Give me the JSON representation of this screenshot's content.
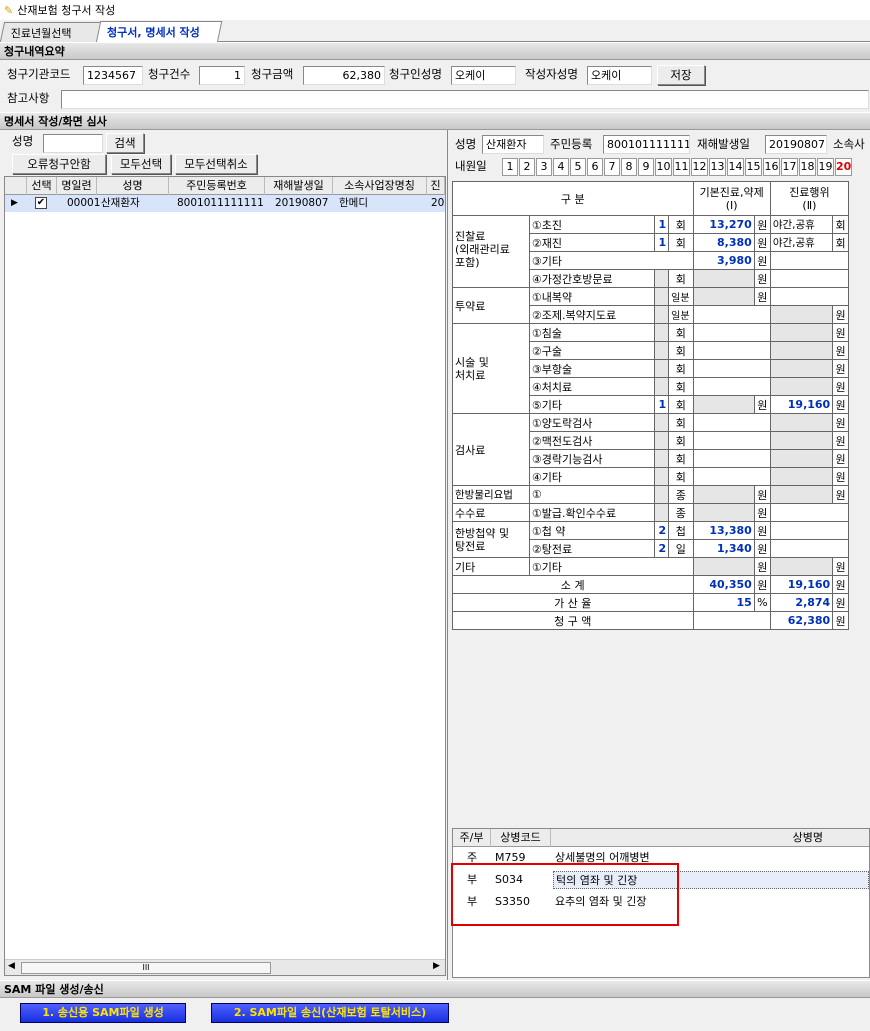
{
  "window": {
    "title": "산재보험 청구서 작성"
  },
  "tabs": [
    {
      "label": "진료년월선택"
    },
    {
      "label": "청구서, 명세서 작성"
    }
  ],
  "summary": {
    "header": "청구내역요약",
    "inst_code_label": "청구기관코드",
    "inst_code": "1234567",
    "count_label": "청구건수",
    "count": "1",
    "amount_label": "청구금액",
    "amount": "62,380",
    "claimant_label": "청구인성명",
    "claimant": "오케이",
    "writer_label": "작성자성명",
    "writer": "오케이",
    "save": "저장",
    "note_label": "참고사항",
    "note": ""
  },
  "review": {
    "header": "명세서 작성/화면 심사"
  },
  "left": {
    "name_label": "성명",
    "name_value": "",
    "search": "검색",
    "btn_error": "오류청구안함",
    "btn_select_all": "모두선택",
    "btn_deselect_all": "모두선택취소",
    "columns": [
      "선택",
      "명일련",
      "성명",
      "주민등록번호",
      "재해발생일",
      "소속사업장명칭",
      "진"
    ],
    "row": {
      "serial": "00001",
      "name": "산재환자",
      "rrn": "8001011111111",
      "date": "20190807",
      "company": "한메디",
      "extra": "20"
    }
  },
  "right": {
    "name_label": "성명",
    "name": "산재환자",
    "rrn_label": "주민등록",
    "rrn": "8001011111111",
    "date_label": "재해발생일",
    "date": "20190807",
    "company_label": "소속사",
    "visit_label": "내원일",
    "days": [
      "1",
      "2",
      "3",
      "4",
      "5",
      "6",
      "7",
      "8",
      "9",
      "10",
      "11",
      "12",
      "13",
      "14",
      "15",
      "16",
      "17",
      "18",
      "19",
      "20"
    ],
    "table": {
      "h_cat": "구 분",
      "h_basic": "기본진료,약제",
      "h_basic2": "(Ⅰ)",
      "h_act": "진료행위",
      "h_act2": "(Ⅱ)",
      "won": "원",
      "hoe": "회",
      "ilbun": "일분",
      "jong": "종",
      "cheop": "첩",
      "il": "일",
      "g_jinchal": "진찰료",
      "g_jinchal2": "(외래관리료",
      "g_jinchal3": "포함)",
      "r_chojin": "①초진",
      "v_chojin_n": "1",
      "v_chojin": "13,270",
      "v_chojin_act": "야간,공휴",
      "r_jaejin": "②재진",
      "v_jaejin_n": "1",
      "v_jaejin": "8,380",
      "v_jaejin_act": "야간,공휴",
      "r_etc": "③기타",
      "v_etc": "3,980",
      "r_home": "④가정간호방문료",
      "g_tuyak": "투약료",
      "r_naebok": "①내복약",
      "r_jojae": "②조제.복약지도료",
      "g_sisul": "시술 및",
      "g_sisul2": "처치료",
      "r_chim": "①침술",
      "r_gu": "②구술",
      "r_buhang": "③부항술",
      "r_cheochi": "④처치료",
      "r_sisul_etc": "⑤기타",
      "v_sisul_n": "1",
      "v_sisul_act": "19,160",
      "g_geomsa": "검사료",
      "r_yangdo": "①양도락검사",
      "r_maek": "②맥전도검사",
      "r_gyeong": "③경락기능검사",
      "r_geom_etc": "④기타",
      "g_hanbang": "한방물리요법",
      "r_hanbang1": "①",
      "g_susu": "수수료",
      "r_susu": "①발급.확인수수료",
      "g_cheop": "한방첩약 및",
      "g_cheop2": "탕전료",
      "r_cheopyak": "①첩   약",
      "v_cheop_n": "2",
      "v_cheop": "13,380",
      "r_tangjeon": "②탕전료",
      "v_tang_n": "2",
      "v_tang": "1,340",
      "g_gita": "기타",
      "r_gita": "①기타",
      "subtotal": "소   계",
      "v_sub1": "40,350",
      "v_sub2": "19,160",
      "gasan": "가 산 율",
      "v_gasan_rate": "15",
      "pct": "%",
      "v_gasan": "2,874",
      "total": "청 구 액",
      "v_total": "62,380"
    },
    "diag": {
      "h_jubu": "주/부",
      "h_code": "상병코드",
      "h_name": "상병명",
      "rows": [
        {
          "type": "주",
          "code": "M759",
          "name": "상세불명의 어깨병변"
        },
        {
          "type": "부",
          "code": "S034",
          "name": "턱의 염좌 및 긴장"
        },
        {
          "type": "부",
          "code": "S3350",
          "name": "요추의 염좌 및 긴장"
        }
      ]
    }
  },
  "sam": {
    "header": "SAM 파일 생성/송신",
    "btn1": "1. 송신용 SAM파일 생성",
    "btn2": "2. SAM파일 송신(산재보험 토탈서비스)"
  },
  "scrollbar": {
    "thumb_glyph": "III"
  }
}
